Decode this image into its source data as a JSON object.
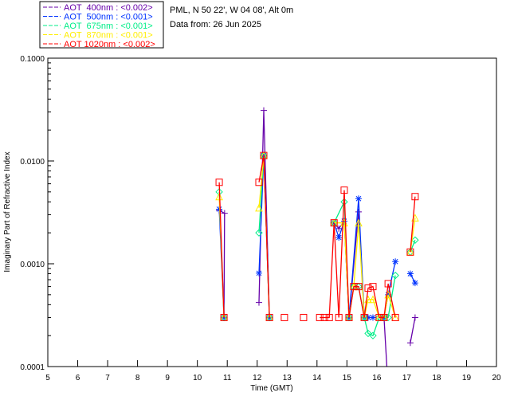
{
  "header": {
    "location": "PML, N 50 22', W 04 08', Alt 0m",
    "date": "Data from: 26 Jun 2025"
  },
  "chart_data": {
    "type": "line",
    "xlabel": "Time (GMT)",
    "ylabel": "Imaginary Part of Refractive Index",
    "xlim": [
      5,
      20
    ],
    "ylim": [
      0.0001,
      0.1
    ],
    "yscale": "log",
    "grid": false,
    "legend_placement": "top-left, outside plot",
    "x_ticks": [
      "5",
      "6",
      "7",
      "8",
      "9",
      "10",
      "11",
      "12",
      "13",
      "14",
      "15",
      "16",
      "17",
      "18",
      "19",
      "20"
    ],
    "y_ticks": [
      "0.0001",
      "0.0010",
      "0.0100",
      "0.1000"
    ],
    "series": [
      {
        "name": "AOT  400nm : <0.002>",
        "color": "#6600aa",
        "marker": "plus",
        "x": [
          10.73,
          10.91,
          10.89,
          12.06,
          12.22,
          12.41,
          14.57,
          14.73,
          14.91,
          15.07,
          15.39,
          15.58,
          15.87,
          16.24,
          16.38,
          17.12,
          17.28
        ],
        "y": [
          0.0033,
          0.0031,
          0.0003,
          0.00042,
          0.031,
          0.0003,
          0.0025,
          0.0022,
          0.0026,
          0.0003,
          0.0032,
          0.0003,
          0.0003,
          0.0003,
          6e-05,
          0.00017,
          0.0003
        ]
      },
      {
        "name": "AOT  500nm : <0.001>",
        "color": "#0033ff",
        "marker": "asterisk",
        "x": [
          10.73,
          10.89,
          12.06,
          12.22,
          12.41,
          14.57,
          14.73,
          14.91,
          15.07,
          15.39,
          15.58,
          15.71,
          15.87,
          16.24,
          16.38,
          16.62,
          17.12,
          17.28
        ],
        "y": [
          0.0034,
          0.0003,
          0.00081,
          0.0113,
          0.0003,
          0.0025,
          0.0018,
          0.0026,
          0.0003,
          0.0043,
          0.0003,
          0.0003,
          0.0003,
          0.0003,
          0.0005,
          0.00105,
          0.0008,
          0.00065
        ]
      },
      {
        "name": "AOT  675nm : <0.001>",
        "color": "#00ee88",
        "marker": "diamond",
        "x": [
          10.73,
          10.89,
          12.06,
          12.22,
          12.41,
          14.57,
          14.91,
          15.07,
          15.23,
          15.39,
          15.58,
          15.71,
          15.87,
          16.08,
          16.24,
          16.38,
          16.62,
          17.12,
          17.28
        ],
        "y": [
          0.005,
          0.0003,
          0.002,
          0.0113,
          0.0003,
          0.0025,
          0.004,
          0.0003,
          0.0006,
          0.0006,
          0.0003,
          0.00021,
          0.0002,
          0.0003,
          0.0003,
          0.0003,
          0.00077,
          0.0013,
          0.0017
        ]
      },
      {
        "name": "AOT  870nm : <0.001>",
        "color": "#ffee00",
        "marker": "triangle",
        "x": [
          10.73,
          10.89,
          12.06,
          12.22,
          12.41,
          14.57,
          14.91,
          15.07,
          15.23,
          15.39,
          15.58,
          15.71,
          15.87,
          16.08,
          16.24,
          16.38,
          16.62,
          17.12,
          17.28
        ],
        "y": [
          0.0045,
          0.0003,
          0.0035,
          0.0113,
          0.0003,
          0.0025,
          0.0025,
          0.0003,
          0.0006,
          0.0025,
          0.0003,
          0.00045,
          0.00045,
          0.0003,
          0.0003,
          0.0005,
          0.0003,
          0.0013,
          0.0028
        ]
      },
      {
        "name": "AOT 1020nm : <0.002>",
        "color": "#ff0000",
        "marker": "square",
        "x": [
          10.73,
          10.89,
          12.06,
          12.22,
          12.41,
          12.91,
          13.55,
          14.09,
          14.25,
          14.41,
          14.57,
          14.73,
          14.91,
          15.07,
          15.23,
          15.39,
          15.58,
          15.71,
          15.87,
          16.08,
          16.24,
          16.38,
          16.62,
          17.12,
          17.28
        ],
        "y": [
          0.0062,
          0.0003,
          0.0062,
          0.0113,
          0.0003,
          0.0003,
          0.0003,
          0.0003,
          0.0003,
          0.0003,
          0.0025,
          0.0003,
          0.0052,
          0.0003,
          0.0006,
          0.0006,
          0.0003,
          0.00058,
          0.0006,
          0.0003,
          0.0003,
          0.00064,
          0.0003,
          0.0013,
          0.0045
        ]
      }
    ]
  }
}
